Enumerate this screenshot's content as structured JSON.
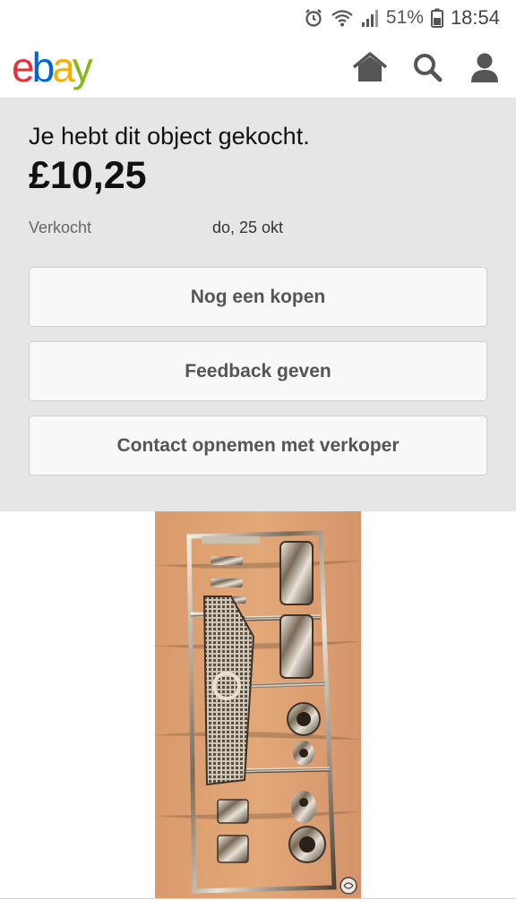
{
  "status_bar": {
    "battery_percent": "51%",
    "time": "18:54"
  },
  "header": {
    "logo": {
      "e": "e",
      "b": "b",
      "a": "a",
      "y": "y"
    },
    "icons": [
      "home-icon",
      "search-icon",
      "user-icon"
    ]
  },
  "purchase": {
    "message": "Je hebt dit object gekocht.",
    "price": "£10,25",
    "sold_label": "Verkocht",
    "sold_date": "do, 25 okt"
  },
  "actions": {
    "buy_again": "Nog een kopen",
    "leave_feedback": "Feedback geven",
    "contact_seller": "Contact opnemen met verkoper"
  },
  "colors": {
    "panel_bg": "#e6e6e6",
    "ebay_red": "#e53238",
    "ebay_blue": "#0064d2",
    "ebay_yellow": "#f5af02",
    "ebay_green": "#86b817"
  }
}
